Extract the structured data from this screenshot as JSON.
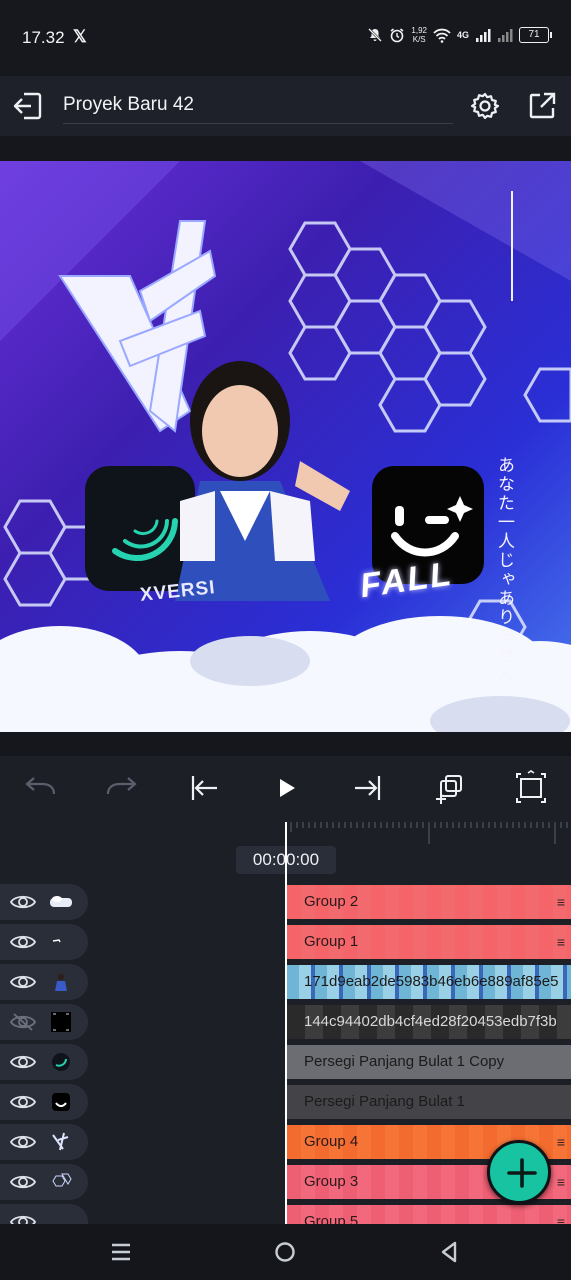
{
  "status_bar": {
    "time": "17.32",
    "network_speed_value": "1,92",
    "network_speed_unit": "K/S",
    "network_type": "4G",
    "battery": "71"
  },
  "app_bar": {
    "project_title": "Proyek Baru 42"
  },
  "preview": {
    "brand_text": "XVERSI",
    "title_text": "FALL",
    "japanese_text": "あなた一人じゃありません"
  },
  "timeline": {
    "timecode": "00:00:00",
    "layers": [
      {
        "label": "Group 2",
        "visible": true,
        "thumb": "clouds-thumb"
      },
      {
        "label": "Group 1",
        "visible": true,
        "thumb": "small-white-thumb"
      },
      {
        "label": "171d9eab2de5983b46eb6e889af85e5",
        "visible": true,
        "thumb": "girl-thumb"
      },
      {
        "label": "144c94402db4cf4ed28f20453edb7f3b",
        "visible": false,
        "thumb": "frame-thumb"
      },
      {
        "label": "Persegi Panjang Bulat 1 Copy",
        "visible": true,
        "thumb": "alight-logo-thumb"
      },
      {
        "label": "Persegi Panjang Bulat 1",
        "visible": true,
        "thumb": "smile-logo-thumb"
      },
      {
        "label": "Group 4",
        "visible": true,
        "thumb": "xversi-logo-thumb"
      },
      {
        "label": "Group 3",
        "visible": true,
        "thumb": "hex-thumb"
      },
      {
        "label": "Group 5",
        "visible": true,
        "thumb": "blank-thumb"
      }
    ]
  },
  "colors": {
    "accent": "#18c3a2",
    "track_red": "#f46468",
    "track_orange": "#f36b2f",
    "track_pink": "#ef5f74"
  }
}
